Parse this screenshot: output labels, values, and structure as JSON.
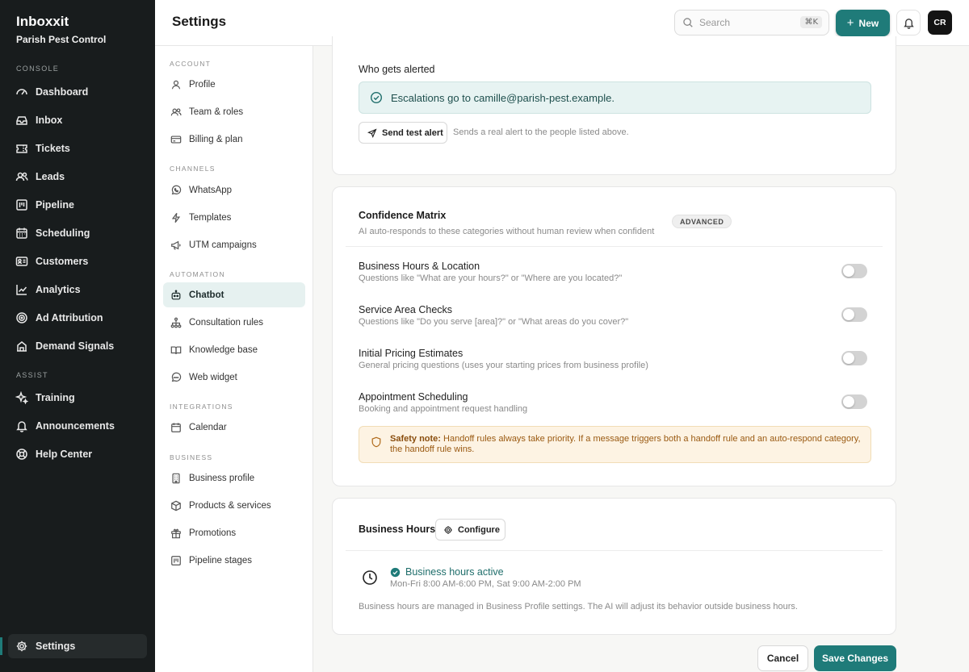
{
  "sidebar": {
    "brand": "Inboxxit",
    "org": "Parish Pest Control",
    "console_label": "CONSOLE",
    "assist_label": "ASSIST",
    "items": [
      {
        "label": "Dashboard",
        "icon": "gauge-icon"
      },
      {
        "label": "Inbox",
        "icon": "inbox-icon"
      },
      {
        "label": "Tickets",
        "icon": "ticket-icon"
      },
      {
        "label": "Leads",
        "icon": "users-icon"
      },
      {
        "label": "Pipeline",
        "icon": "kanban-icon"
      },
      {
        "label": "Scheduling",
        "icon": "calendar-icon"
      },
      {
        "label": "Customers",
        "icon": "id-card-icon"
      },
      {
        "label": "Analytics",
        "icon": "chart-line-icon"
      },
      {
        "label": "Ad Attribution",
        "icon": "target-icon"
      },
      {
        "label": "Demand Signals",
        "icon": "building-icon"
      }
    ],
    "assist_items": [
      {
        "label": "Training",
        "icon": "sparkles-icon"
      },
      {
        "label": "Announcements",
        "icon": "bell-icon"
      },
      {
        "label": "Help Center",
        "icon": "lifebuoy-icon"
      }
    ],
    "settings_label": "Settings"
  },
  "header": {
    "title": "Settings",
    "search_placeholder": "Search",
    "search_shortcut": "⌘K",
    "new_label": "New",
    "avatar_initials": "CR"
  },
  "settings_nav": {
    "account_label": "ACCOUNT",
    "profile": "Profile",
    "team": "Team & roles",
    "billing": "Billing & plan",
    "channels_label": "CHANNELS",
    "whatsapp": "WhatsApp",
    "templates": "Templates",
    "utm": "UTM campaigns",
    "automation_label": "AUTOMATION",
    "chatbot": "Chatbot",
    "consultation": "Consultation rules",
    "knowledge": "Knowledge base",
    "widget": "Web widget",
    "integrations_label": "INTEGRATIONS",
    "calendar": "Calendar",
    "business_label": "BUSINESS",
    "business_profile": "Business profile",
    "products": "Products & services",
    "promotions": "Promotions",
    "pipeline_stages": "Pipeline stages"
  },
  "alerts": {
    "who_label": "Who gets alerted",
    "escalation_text": "Escalations go to camille@parish-pest.example.",
    "test_button": "Send test alert",
    "test_hint": "Sends a real alert to the people listed above."
  },
  "matrix": {
    "title": "Confidence Matrix",
    "badge": "ADVANCED",
    "subtitle": "AI auto-responds to these categories without human review when confident",
    "rows": [
      {
        "title": "Business Hours & Location",
        "desc": "Questions like \"What are your hours?\" or \"Where are you located?\"",
        "enabled": false
      },
      {
        "title": "Service Area Checks",
        "desc": "Questions like \"Do you serve [area]?\" or \"What areas do you cover?\"",
        "enabled": false
      },
      {
        "title": "Initial Pricing Estimates",
        "desc": "General pricing questions (uses your starting prices from business profile)",
        "enabled": false
      },
      {
        "title": "Appointment Scheduling",
        "desc": "Booking and appointment request handling",
        "enabled": false
      }
    ],
    "safety_label": "Safety note:",
    "safety_text": "Handoff rules always take priority. If a message triggers both a handoff rule and an auto-respond category, the handoff rule wins."
  },
  "hours": {
    "title": "Business Hours",
    "configure": "Configure",
    "status": "Business hours active",
    "times": "Mon-Fri 8:00 AM-6:00 PM, Sat 9:00 AM-2:00 PM",
    "managed": "Business hours are managed in Business Profile settings. The AI will adjust its behavior outside business hours."
  },
  "footer": {
    "cancel": "Cancel",
    "save": "Save Changes"
  },
  "colors": {
    "accent": "#1f7b79",
    "sidebar_bg": "#181c1d",
    "safety_bg": "#fdf3e3"
  }
}
